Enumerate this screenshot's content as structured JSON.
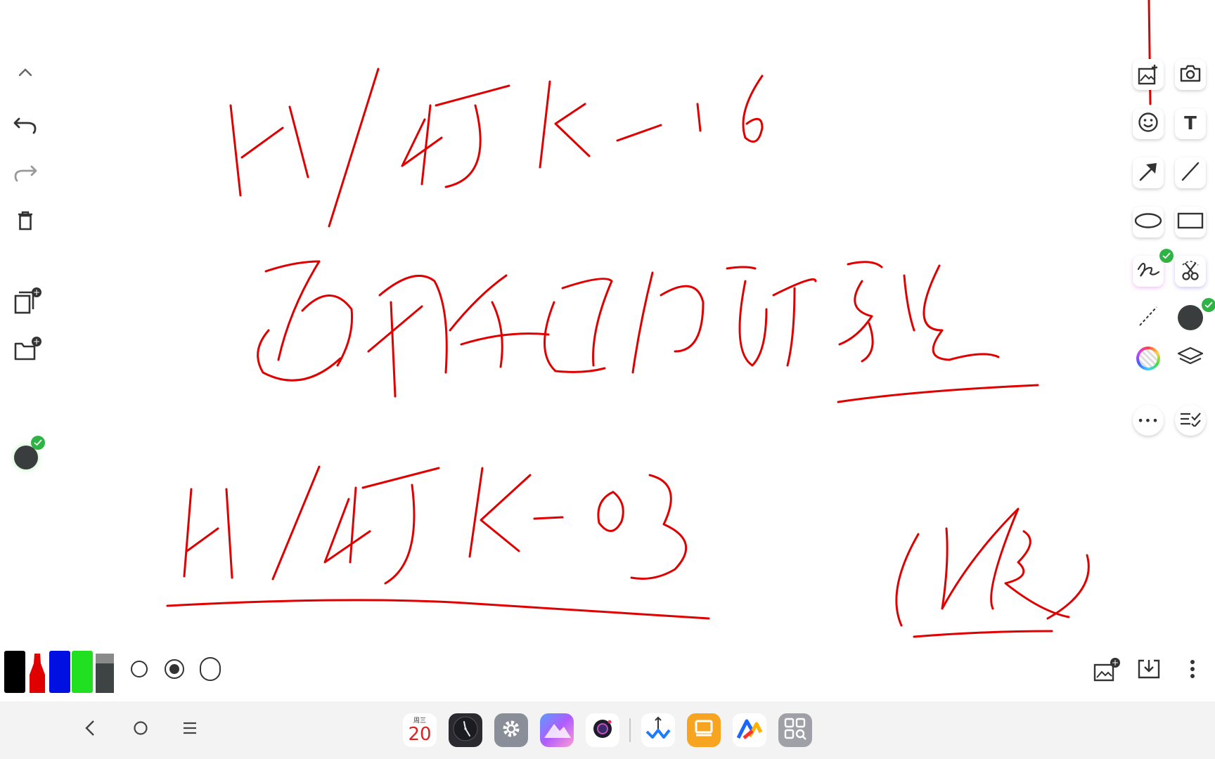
{
  "toolbar_left": {
    "collapse_icon": "chevron-up-icon",
    "undo_icon": "undo-icon",
    "redo_icon": "redo-icon",
    "delete_icon": "trash-icon",
    "new_page_icon": "copy-plus-icon",
    "new_folder_icon": "folder-plus-icon",
    "current_color": "#3a3d3e"
  },
  "toolbar_right": {
    "tools": [
      {
        "name": "insert-image",
        "icon": "image-plus-icon"
      },
      {
        "name": "camera",
        "icon": "camera-icon"
      },
      {
        "name": "sticker",
        "icon": "smiley-icon"
      },
      {
        "name": "text",
        "icon": "text-icon",
        "label": "T"
      },
      {
        "name": "arrow",
        "icon": "arrow-icon"
      },
      {
        "name": "line",
        "icon": "line-icon"
      },
      {
        "name": "ellipse",
        "icon": "ellipse-icon"
      },
      {
        "name": "rectangle",
        "icon": "rectangle-icon"
      },
      {
        "name": "freehand",
        "icon": "freehand-icon",
        "selected": true
      },
      {
        "name": "scissors",
        "icon": "scissors-icon"
      },
      {
        "name": "dashed-line",
        "icon": "dashed-line-icon"
      },
      {
        "name": "color",
        "icon": "color-dot-icon",
        "selected": true
      },
      {
        "name": "color-wheel",
        "icon": "color-wheel-icon"
      },
      {
        "name": "layers",
        "icon": "layers-icon"
      },
      {
        "name": "more",
        "icon": "more-horizontal-icon",
        "label": "•••"
      },
      {
        "name": "checklist",
        "icon": "checklist-icon"
      }
    ]
  },
  "pens": {
    "colors": [
      "#000000",
      "#e00000",
      "#0010e0",
      "#21e021",
      "#4a4a4a"
    ],
    "sizes": [
      "small",
      "medium",
      "large"
    ],
    "selected_size": "medium"
  },
  "bottom_right": {
    "insert_icon": "image-plus-icon",
    "save_icon": "download-icon",
    "menu_icon": "more-vertical-icon"
  },
  "navbar": {
    "back_icon": "back-icon",
    "home_icon": "home-icon",
    "recents_icon": "recents-icon"
  },
  "dock": {
    "calendar": {
      "weekday": "周三",
      "day": "20"
    },
    "apps": [
      "calendar",
      "clock",
      "settings",
      "gallery",
      "camera",
      "task-app",
      "slides-app",
      "office-app",
      "app-drawer"
    ]
  },
  "ink_color": "#e00000"
}
